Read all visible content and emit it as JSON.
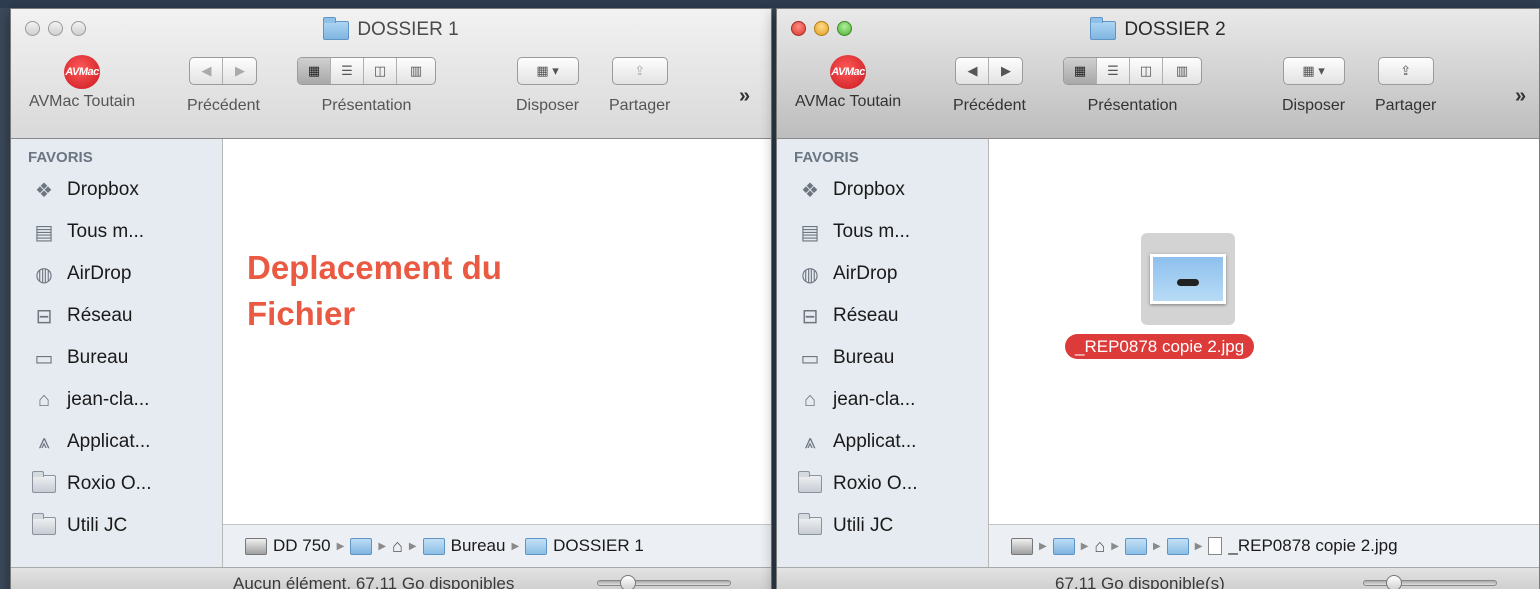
{
  "window_left": {
    "title": "DOSSIER 1",
    "toolbar": {
      "app_label": "AVMac Toutain",
      "logo_text": "AVMac",
      "back_label": "Précédent",
      "view_label": "Présentation",
      "arrange_label": "Disposer",
      "share_label": "Partager",
      "more": "»"
    },
    "sidebar": {
      "heading": "FAVORIS",
      "items": [
        {
          "label": "Dropbox",
          "icon": "dropbox-icon"
        },
        {
          "label": "Tous m...",
          "icon": "all-files-icon"
        },
        {
          "label": "AirDrop",
          "icon": "airdrop-icon"
        },
        {
          "label": "Réseau",
          "icon": "network-icon"
        },
        {
          "label": "Bureau",
          "icon": "desktop-icon"
        },
        {
          "label": "jean-cla...",
          "icon": "home-icon"
        },
        {
          "label": "Applicat...",
          "icon": "applications-icon"
        },
        {
          "label": "Roxio O...",
          "icon": "folder-icon"
        },
        {
          "label": "Utili JC",
          "icon": "folder-icon"
        }
      ]
    },
    "annotation": "Deplacement du\nFichier",
    "pathbar": {
      "disk": "DD 750",
      "bureau": "Bureau",
      "dossier": "DOSSIER 1"
    },
    "status": "Aucun élément, 67,11 Go disponibles"
  },
  "window_right": {
    "title": "DOSSIER 2",
    "toolbar": {
      "app_label": "AVMac Toutain",
      "logo_text": "AVMac",
      "back_label": "Précédent",
      "view_label": "Présentation",
      "arrange_label": "Disposer",
      "share_label": "Partager",
      "more": "»"
    },
    "sidebar": {
      "heading": "FAVORIS",
      "items": [
        {
          "label": "Dropbox",
          "icon": "dropbox-icon"
        },
        {
          "label": "Tous m...",
          "icon": "all-files-icon"
        },
        {
          "label": "AirDrop",
          "icon": "airdrop-icon"
        },
        {
          "label": "Réseau",
          "icon": "network-icon"
        },
        {
          "label": "Bureau",
          "icon": "desktop-icon"
        },
        {
          "label": "jean-cla...",
          "icon": "home-icon"
        },
        {
          "label": "Applicat...",
          "icon": "applications-icon"
        },
        {
          "label": "Roxio O...",
          "icon": "folder-icon"
        },
        {
          "label": "Utili JC",
          "icon": "folder-icon"
        }
      ]
    },
    "file": {
      "name": "_REP0878 copie 2.jpg"
    },
    "pathbar": {
      "file": "_REP0878 copie 2.jpg"
    },
    "status": "67,11 Go disponible(s)"
  },
  "colors": {
    "annotation": "#ea5a43",
    "selection": "#dd3a3a",
    "sidebar_bg": "#e6ebf1"
  }
}
